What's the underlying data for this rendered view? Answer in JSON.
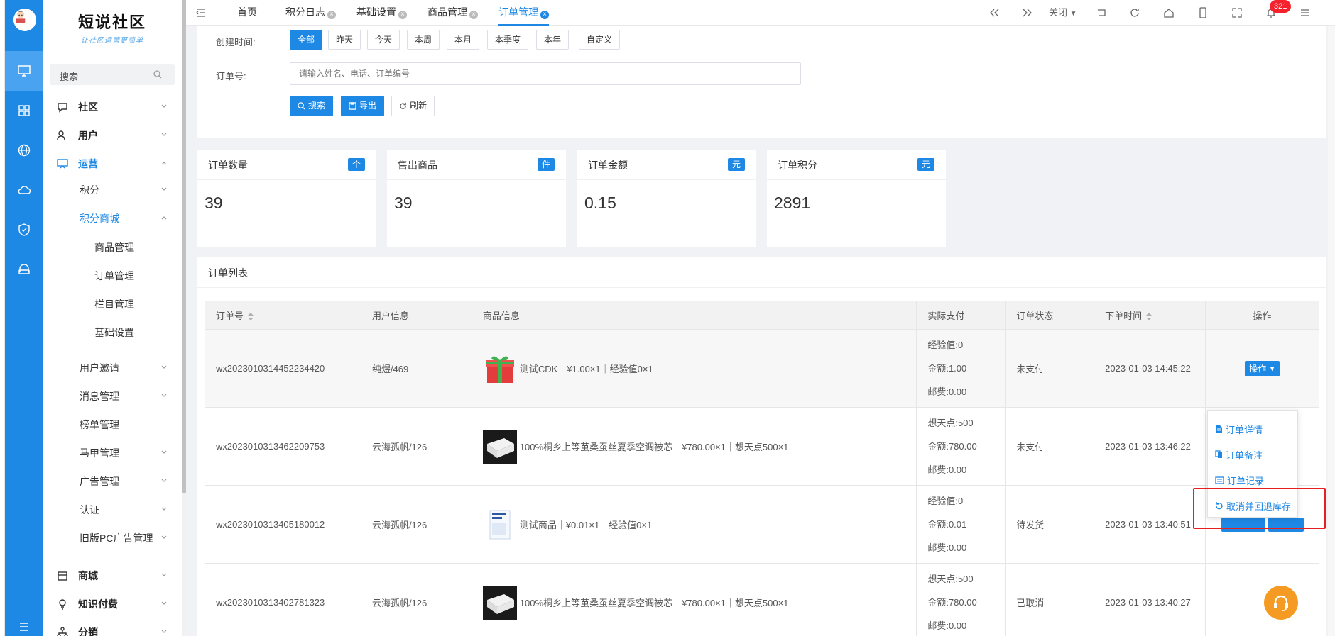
{
  "brand": {
    "title": "短说社区",
    "subtitle": "让社区运营更简单"
  },
  "sidebar": {
    "search_label": "搜索",
    "items": [
      {
        "label": "社区"
      },
      {
        "label": "用户"
      },
      {
        "label": "运营"
      },
      {
        "label": "积分"
      },
      {
        "label": "积分商城"
      },
      {
        "label": "商品管理"
      },
      {
        "label": "订单管理"
      },
      {
        "label": "栏目管理"
      },
      {
        "label": "基础设置"
      },
      {
        "label": "用户邀请"
      },
      {
        "label": "消息管理"
      },
      {
        "label": "榜单管理"
      },
      {
        "label": "马甲管理"
      },
      {
        "label": "广告管理"
      },
      {
        "label": "认证"
      },
      {
        "label": "旧版PC广告管理"
      },
      {
        "label": "商城"
      },
      {
        "label": "知识付费"
      },
      {
        "label": "分销"
      }
    ]
  },
  "topbar": {
    "tabs": [
      {
        "label": "首页"
      },
      {
        "label": "积分日志"
      },
      {
        "label": "基础设置"
      },
      {
        "label": "商品管理"
      },
      {
        "label": "订单管理"
      }
    ],
    "close_label": "关闭",
    "notification_count": "321"
  },
  "filters": {
    "created_label": "创建时间:",
    "date_options": [
      "全部",
      "昨天",
      "今天",
      "本周",
      "本月",
      "本季度",
      "本年",
      "自定义"
    ],
    "order_label": "订单号:",
    "order_placeholder": "请输入姓名、电话、订单编号",
    "search_btn": "搜索",
    "export_btn": "导出",
    "refresh_btn": "刷新"
  },
  "stats": [
    {
      "title": "订单数量",
      "unit": "个",
      "value": "39"
    },
    {
      "title": "售出商品",
      "unit": "件",
      "value": "39"
    },
    {
      "title": "订单金额",
      "unit": "元",
      "value": "0.15"
    },
    {
      "title": "订单积分",
      "unit": "元",
      "value": "2891"
    }
  ],
  "order_list": {
    "title": "订单列表",
    "columns": [
      "订单号",
      "用户信息",
      "商品信息",
      "实际支付",
      "订单状态",
      "下单时间",
      "操作"
    ],
    "op_label": "操作",
    "rows": [
      {
        "order_no": "wx2023010314452234420",
        "user": "纯煜/469",
        "goods": "测试CDK｜¥1.00×1｜经验值0×1",
        "pay": [
          "经验值:0",
          "金额:1.00",
          "邮费:0.00"
        ],
        "status": "未支付",
        "time": "2023-01-03 14:45:22"
      },
      {
        "order_no": "wx2023010313462209753",
        "user": "云海孤帆/126",
        "goods": "100%桐乡上等茧桑蚕丝夏季空调被芯｜¥780.00×1｜想天点500×1",
        "pay": [
          "想天点:500",
          "金额:780.00",
          "邮费:0.00"
        ],
        "status": "未支付",
        "time": "2023-01-03 13:46:22"
      },
      {
        "order_no": "wx2023010313405180012",
        "user": "云海孤帆/126",
        "goods": "测试商品｜¥0.01×1｜经验值0×1",
        "pay": [
          "经验值:0",
          "金额:0.01",
          "邮费:0.00"
        ],
        "status": "待发货",
        "time": "2023-01-03 13:40:51"
      },
      {
        "order_no": "wx2023010313402781323",
        "user": "云海孤帆/126",
        "goods": "100%桐乡上等茧桑蚕丝夏季空调被芯｜¥780.00×1｜想天点500×1",
        "pay": [
          "想天点:500",
          "金额:780.00",
          "邮费:0.00"
        ],
        "status": "已取消",
        "time": "2023-01-03 13:40:27"
      }
    ]
  },
  "dropdown": {
    "items": [
      "订单详情",
      "订单备注",
      "订单记录",
      "取消并回退库存"
    ]
  },
  "colors": {
    "primary": "#1e88e5",
    "highlight": "#e62020",
    "fab": "#f59b23"
  }
}
